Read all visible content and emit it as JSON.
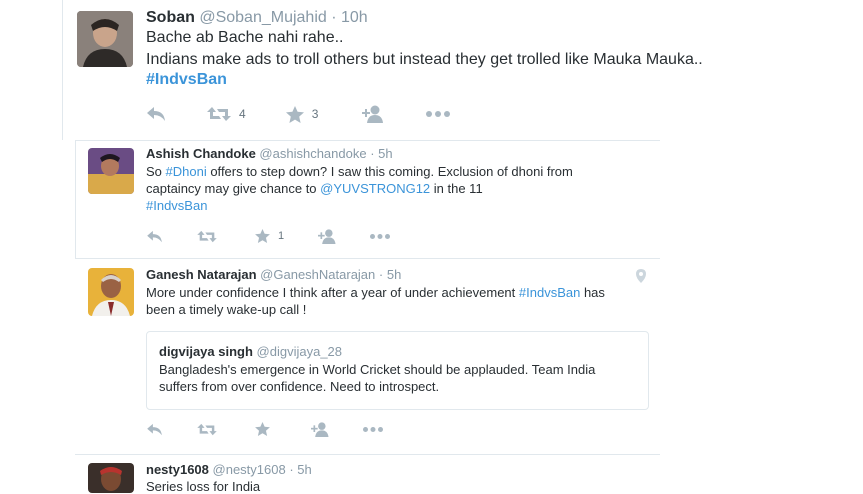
{
  "tweets": [
    {
      "name": "Soban",
      "handle": "@Soban_Mujahid",
      "time": "· 10h",
      "line1": "Bache ab Bache nahi rahe..",
      "line2": "Indians make ads to troll others but instead they get trolled like Mauka Mauka..",
      "hashtag": "#IndvsBan",
      "retweets": "4",
      "likes": "3"
    },
    {
      "name": "Ashish Chandoke",
      "handle": "@ashishchandoke",
      "time": "· 5h",
      "line1_pre": "So ",
      "line1_tag": "#Dhoni",
      "line1_post": " offers to step down? I saw this coming. Exclusion of dhoni from",
      "line2_pre": "captaincy may give chance to ",
      "line2_mention": "@YUVSTRONG12",
      "line2_post": " in the 11",
      "hashtag": "#IndvsBan",
      "likes": "1"
    },
    {
      "name": "Ganesh Natarajan",
      "handle": "@GaneshNatarajan",
      "time": "· 5h",
      "line1_pre": "More under confidence I think after a year of under achievement ",
      "line1_tag": "#IndvsBan",
      "line1_post": " has",
      "line2": "been a timely wake-up call !",
      "quote": {
        "name": "digvijaya singh",
        "handle": "@digvijaya_28",
        "line1": "Bangladesh's emergence in World Cricket should be applauded. Team India",
        "line2": "suffers from over confidence. Need to introspect."
      }
    },
    {
      "name": "nesty1608",
      "handle": "@nesty1608",
      "time": "· 5h",
      "line1": "Series loss for India"
    }
  ]
}
